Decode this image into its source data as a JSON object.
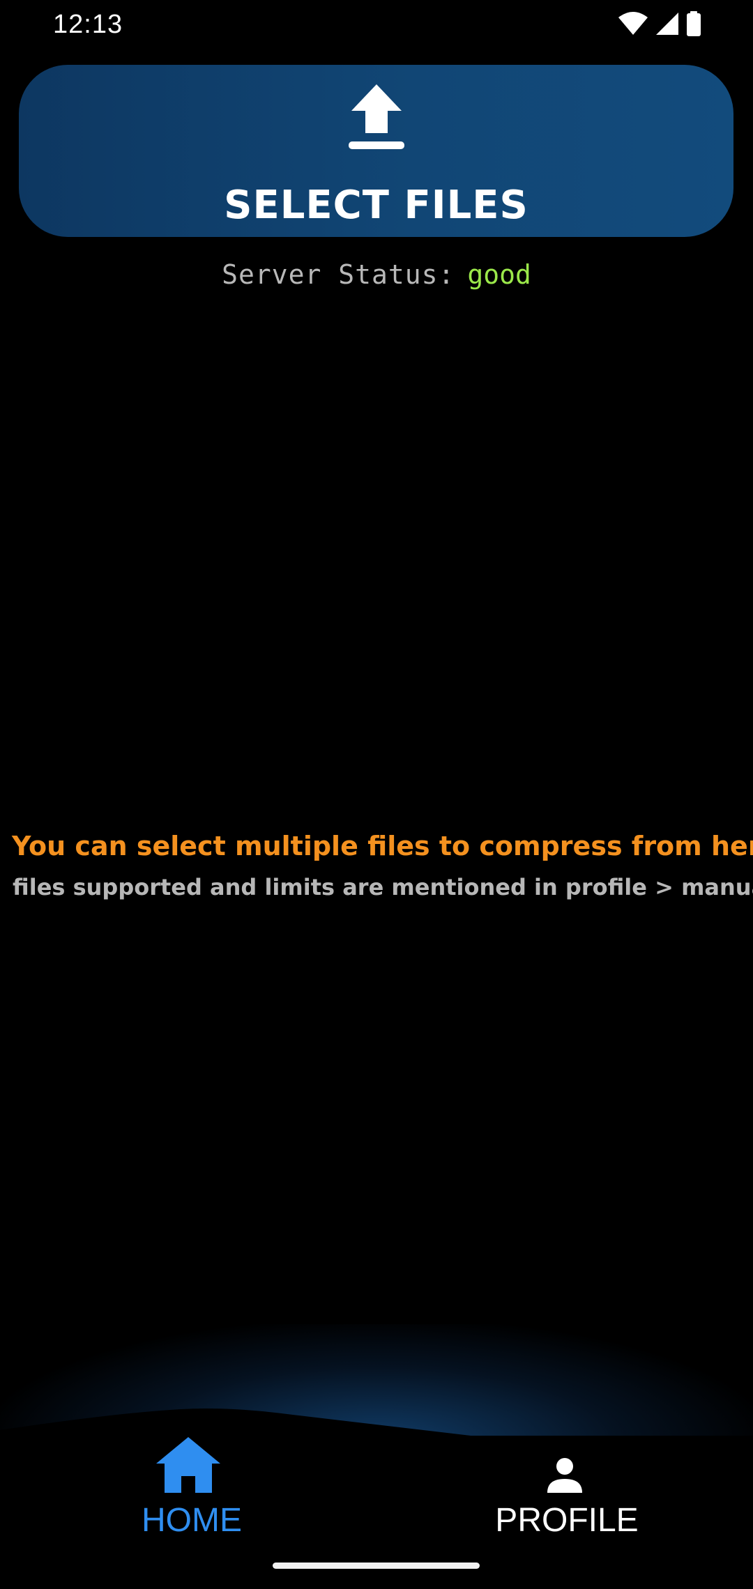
{
  "status_bar": {
    "time": "12:13"
  },
  "select_files": {
    "label": "SELECT FILES",
    "icon": "upload-icon",
    "background_color": "#114675"
  },
  "server_status": {
    "label": "Server Status:",
    "value": "good",
    "value_color": "#9be84a"
  },
  "info": {
    "primary": "You can select multiple files to compress from here",
    "primary_color": "#f4911f",
    "secondary": "files supported and limits are mentioned in profile > manual"
  },
  "bottom_nav": {
    "items": [
      {
        "label": "HOME",
        "icon": "home-icon",
        "active": true,
        "color": "#2f8ef0"
      },
      {
        "label": "PROFILE",
        "icon": "person-icon",
        "active": false,
        "color": "#ffffff"
      }
    ]
  }
}
